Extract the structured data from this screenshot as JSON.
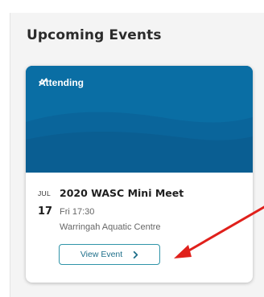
{
  "section": {
    "title": "Upcoming Events"
  },
  "event": {
    "status_label": "Attending",
    "status_icon": "check-icon",
    "month": "JUL",
    "day": "17",
    "title": "2020 WASC Mini Meet",
    "time": "Fri 17:30",
    "venue": "Warringah Aquatic Centre",
    "button_label": "View Event",
    "button_icon": "chevron-right-icon"
  },
  "colors": {
    "banner": "#0a6ea4",
    "button_border": "#2f94a8",
    "annotation_arrow": "#e0201b"
  }
}
